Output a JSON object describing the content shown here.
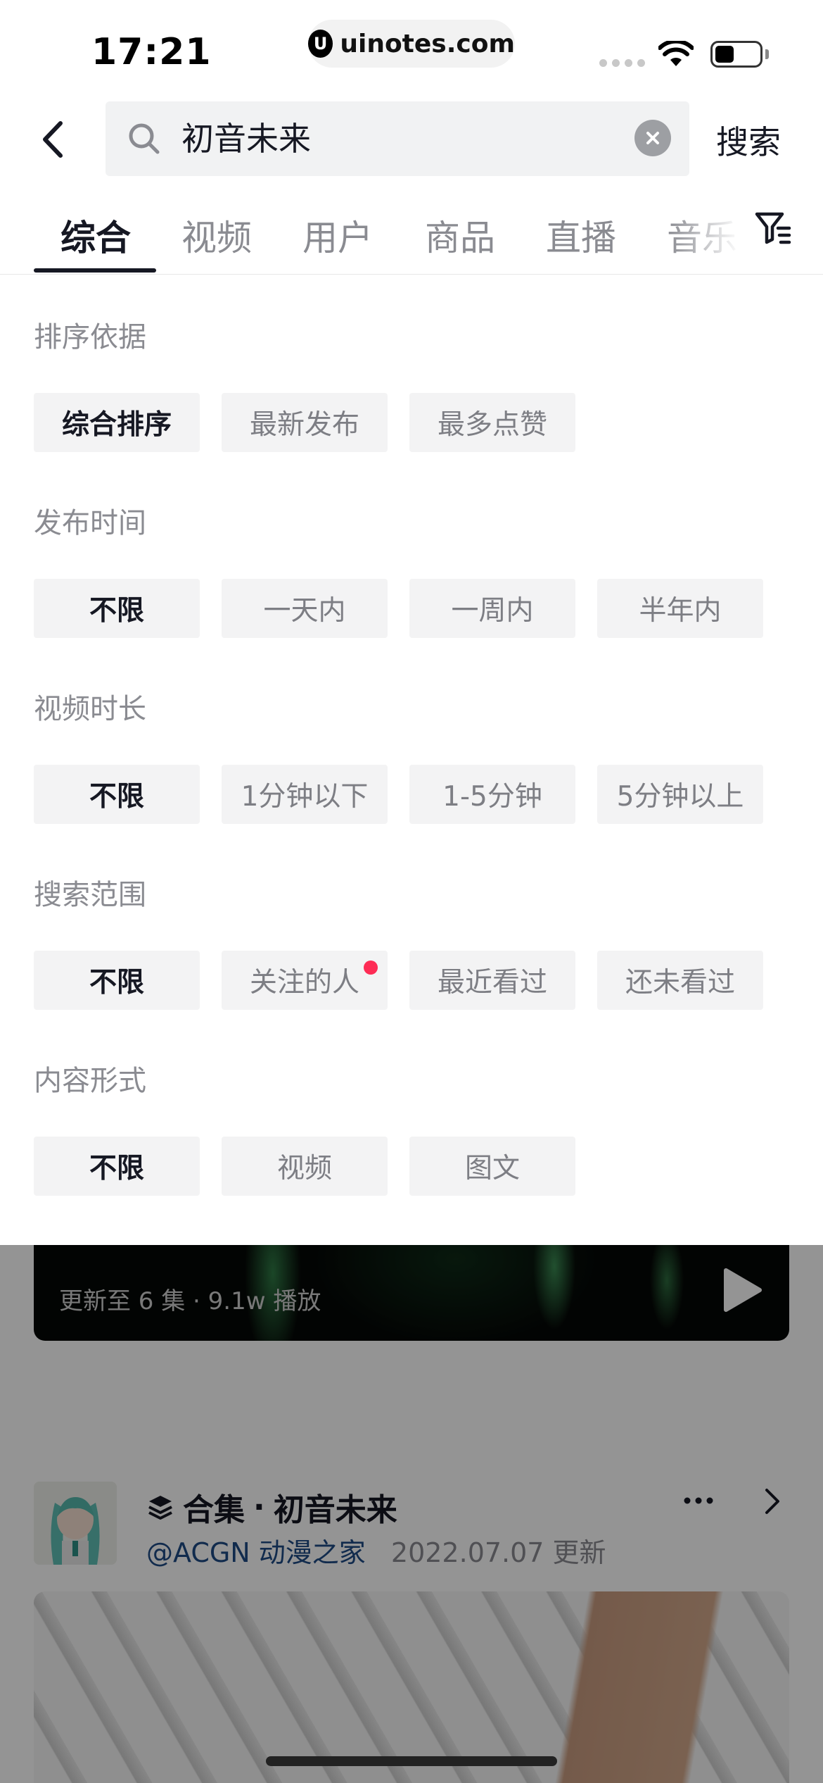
{
  "status_bar": {
    "time": "17:21",
    "url": "uinotes.com",
    "url_logo": "U",
    "icons": [
      "signal-dots-icon",
      "wifi-icon",
      "battery-icon"
    ]
  },
  "search": {
    "query": "初音未来",
    "submit_label": "搜索"
  },
  "tabs": [
    {
      "label": "综合",
      "active": true
    },
    {
      "label": "视频"
    },
    {
      "label": "用户"
    },
    {
      "label": "商品"
    },
    {
      "label": "直播"
    },
    {
      "label": "音乐"
    }
  ],
  "filter": {
    "sections": [
      {
        "title": "排序依据",
        "options": [
          "综合排序",
          "最新发布",
          "最多点赞"
        ],
        "selected": "综合排序"
      },
      {
        "title": "发布时间",
        "options": [
          "不限",
          "一天内",
          "一周内",
          "半年内"
        ],
        "selected": "不限"
      },
      {
        "title": "视频时长",
        "options": [
          "不限",
          "1分钟以下",
          "1-5分钟",
          "5分钟以上"
        ],
        "selected": "不限"
      },
      {
        "title": "搜索范围",
        "options": [
          "不限",
          "关注的人",
          "最近看过",
          "还未看过"
        ],
        "selected": "不限",
        "badge_on": "关注的人"
      },
      {
        "title": "内容形式",
        "options": [
          "不限",
          "视频",
          "图文"
        ],
        "selected": "不限"
      }
    ]
  },
  "background": {
    "video_meta": "更新至 6 集 · 9.1w 播放",
    "collection_label": "合集",
    "collection_dot": "·",
    "collection_title": "初音未来",
    "author": "@ACGN 动漫之家",
    "updated": "2022.07.07 更新"
  },
  "colors": {
    "accent_red": "#fe2c55",
    "text_primary": "#161823",
    "text_secondary": "#8a8b91",
    "chip_bg": "#f3f3f4",
    "author_link": "#1e4b86"
  }
}
